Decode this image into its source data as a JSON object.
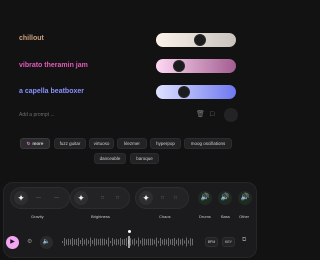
{
  "prompts": [
    {
      "label": "chillout",
      "color": "#c9a17b",
      "slider_colors": [
        "#fbf2ea",
        "#c8c2bd"
      ],
      "level": 0.55
    },
    {
      "label": "vibrato theramin jam",
      "color": "#e05bb9",
      "slider_colors": [
        "#ffd8f3",
        "#a25d90"
      ],
      "level": 0.28
    },
    {
      "label": "a capella beatboxer",
      "color": "#8691ff",
      "slider_colors": [
        "#dfe2ff",
        "#6e78f0"
      ],
      "level": 0.33
    }
  ],
  "add_prompt": {
    "placeholder": "Add a prompt ..."
  },
  "chips": {
    "more": "more",
    "items": [
      "fuzz guitar",
      "virtuoso",
      "klezmer",
      "hyperpop",
      "moog oscillations",
      "danceable",
      "baroque"
    ]
  },
  "controls": {
    "knobs": [
      "Gravity",
      "Brightness",
      "Chaos"
    ],
    "knob_placeholder": "—",
    "stems": [
      "Drums",
      "Bass",
      "Other"
    ]
  },
  "transport": {
    "bpm_label": "BPM",
    "key_label": "KEY",
    "playhead": 0.5
  },
  "icons": {
    "trash": "trash-icon",
    "add": "add-icon",
    "star": "sparkle-icon",
    "speaker": "speaker-icon",
    "play": "play-icon",
    "share": "share-icon"
  }
}
